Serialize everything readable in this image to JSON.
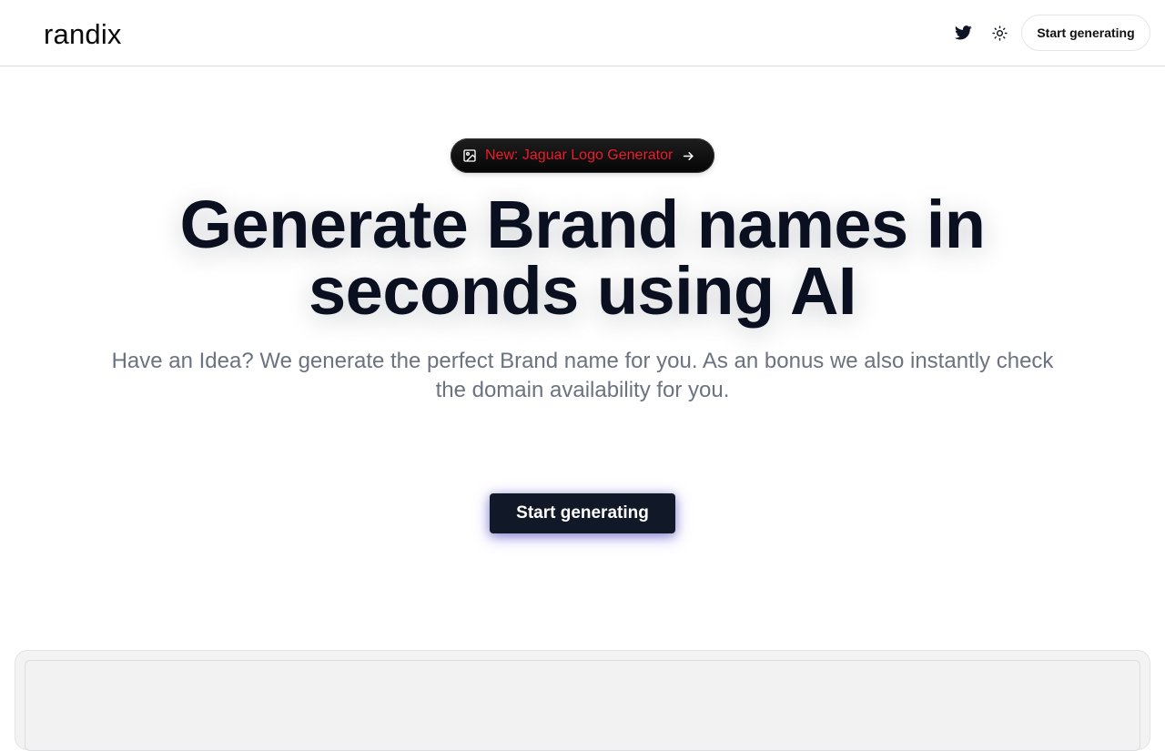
{
  "navbar": {
    "brand": "randix",
    "icons": [
      "twitter-icon",
      "sun-icon"
    ],
    "cta_label": "Start generating"
  },
  "announcement": {
    "icon": "image-icon",
    "text": "New: Jaguar Logo Generator",
    "arrow_icon": "arrow-right-icon",
    "text_color": "#ee1b2c"
  },
  "hero": {
    "headline_line1": "Generate Brand names in",
    "headline_line2": "seconds using AI",
    "subtext": "Have an Idea? We generate the perfect Brand name for you. As an bonus we also instantly check the domain availability for you.",
    "cta_label": "Start generating"
  },
  "colors": {
    "cta_background": "#111827",
    "cta_glow": "#5850ec",
    "headline": "#0b1020",
    "subtext": "#6b7280"
  }
}
